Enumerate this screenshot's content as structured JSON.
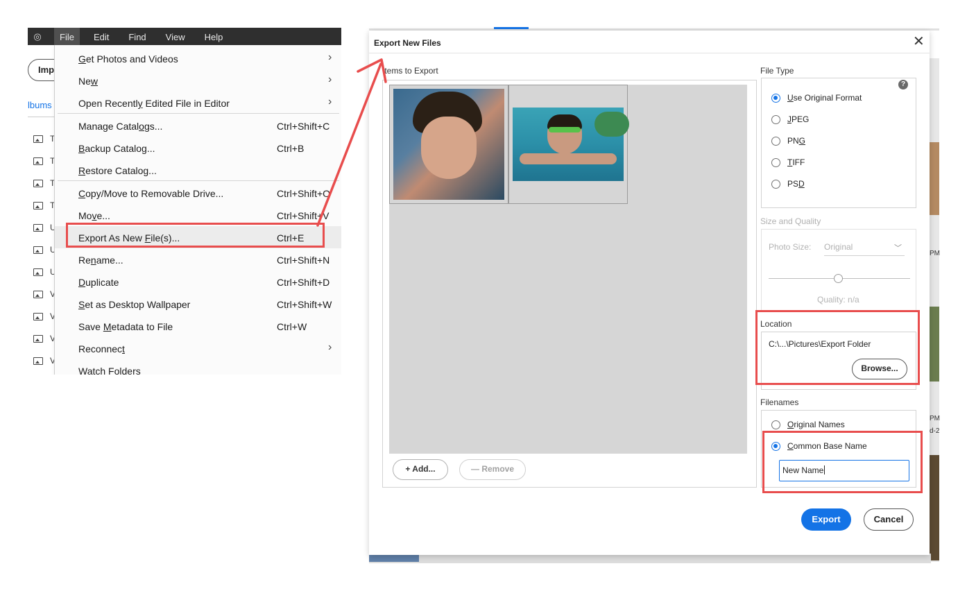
{
  "app": {
    "menubar": {
      "file": "File",
      "edit": "Edit",
      "find": "Find",
      "view": "View",
      "help": "Help"
    },
    "side": {
      "import_btn": "Imp",
      "albums_tab": "lbums",
      "letters": [
        "T",
        "T",
        "T",
        "T",
        "U",
        "U",
        "U",
        "V",
        "V",
        "V",
        "V"
      ]
    }
  },
  "file_menu": {
    "items": [
      {
        "label_pre": "",
        "label_u": "G",
        "label_post": "et Photos and Videos",
        "shortcut": "",
        "submenu": true
      },
      {
        "label_pre": "Ne",
        "label_u": "w",
        "label_post": "",
        "shortcut": "",
        "submenu": true
      },
      {
        "label_pre": "Open Recentl",
        "label_u": "y",
        "label_post": " Edited File in Editor",
        "shortcut": "",
        "submenu": true
      },
      {
        "label_pre": "Manage Catal",
        "label_u": "o",
        "label_post": "gs...",
        "shortcut": "Ctrl+Shift+C",
        "submenu": false
      },
      {
        "label_pre": "",
        "label_u": "B",
        "label_post": "ackup Catalog...",
        "shortcut": "Ctrl+B",
        "submenu": false
      },
      {
        "label_pre": "",
        "label_u": "R",
        "label_post": "estore Catalog...",
        "shortcut": "",
        "submenu": false
      },
      {
        "label_pre": "",
        "label_u": "C",
        "label_post": "opy/Move to Removable Drive...",
        "shortcut": "Ctrl+Shift+O",
        "submenu": false
      },
      {
        "label_pre": "Mo",
        "label_u": "v",
        "label_post": "e...",
        "shortcut": "Ctrl+Shift+V",
        "submenu": false
      },
      {
        "label_pre": "Export As New ",
        "label_u": "F",
        "label_post": "ile(s)...",
        "shortcut": "Ctrl+E",
        "submenu": false
      },
      {
        "label_pre": "Re",
        "label_u": "n",
        "label_post": "ame...",
        "shortcut": "Ctrl+Shift+N",
        "submenu": false
      },
      {
        "label_pre": "",
        "label_u": "D",
        "label_post": "uplicate",
        "shortcut": "Ctrl+Shift+D",
        "submenu": false
      },
      {
        "label_pre": "",
        "label_u": "S",
        "label_post": "et as Desktop Wallpaper",
        "shortcut": "Ctrl+Shift+W",
        "submenu": false
      },
      {
        "label_pre": "Save ",
        "label_u": "M",
        "label_post": "etadata to File",
        "shortcut": "Ctrl+W",
        "submenu": false
      },
      {
        "label_pre": "Reconnec",
        "label_u": "t",
        "label_post": "",
        "shortcut": "",
        "submenu": true
      },
      {
        "label_pre": "Watch Folders",
        "label_u": "",
        "label_post": "",
        "shortcut": "",
        "submenu": false
      }
    ]
  },
  "dialog": {
    "title": "Export New Files",
    "close_glyph": "✕",
    "items_label": "Items to Export",
    "add_label": "+ Add...",
    "remove_label": "— Remove",
    "file_type": {
      "label": "File Type",
      "help_glyph": "?",
      "options": [
        {
          "pre": "",
          "u": "U",
          "post": "se Original Format",
          "selected": true
        },
        {
          "pre": "",
          "u": "J",
          "post": "PEG",
          "selected": false
        },
        {
          "pre": "PN",
          "u": "G",
          "post": "",
          "selected": false
        },
        {
          "pre": "",
          "u": "T",
          "post": "IFF",
          "selected": false
        },
        {
          "pre": "PS",
          "u": "D",
          "post": "",
          "selected": false
        }
      ]
    },
    "size_quality": {
      "label": "Size and Quality",
      "photo_size_label": "Photo Size:",
      "photo_size_value": "Original",
      "quality_label": "Quality: n/a"
    },
    "location": {
      "label": "Location",
      "path": "C:\\...\\Pictures\\Export Folder",
      "browse_label": "Browse..."
    },
    "filenames": {
      "label": "Filenames",
      "original_pre": "",
      "original_u": "O",
      "original_post": "riginal Names",
      "common_pre": "",
      "common_u": "C",
      "common_post": "ommon Base Name",
      "base_name_value": "New Name"
    },
    "export_label": "Export",
    "cancel_label": "Cancel"
  },
  "background": {
    "pm_label_1": "PM",
    "pm_label_2": "PM",
    "d2_label": "d-2"
  },
  "colors": {
    "accent": "#1473e6",
    "annotation": "#e84d4d",
    "menubar": "#2f2f2f"
  }
}
